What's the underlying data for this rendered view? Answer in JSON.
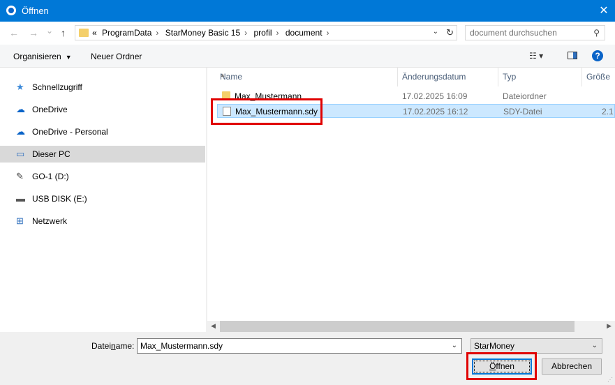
{
  "window": {
    "title": "Öffnen",
    "close_glyph": "✕"
  },
  "nav": {
    "back_glyph": "←",
    "forward_glyph": "→",
    "recent_glyph": "⌄",
    "up_glyph": "↑",
    "breadcrumb_prefix": "«",
    "breadcrumbs": [
      "ProgramData",
      "StarMoney Basic 15",
      "profil",
      "document"
    ],
    "separator": "›",
    "address_dropdown_glyph": "⌄",
    "refresh_glyph": "↻"
  },
  "search": {
    "placeholder": "document durchsuchen",
    "icon": "search-icon"
  },
  "toolbar": {
    "organize_label": "Organisieren",
    "new_folder_label": "Neuer Ordner",
    "view_glyph": "☷ ▾",
    "help_label": "?"
  },
  "sidebar": {
    "items": [
      {
        "label": "Schnellzugriff",
        "icon": "star-icon",
        "glyph": "★",
        "color": "#3a88d8"
      },
      {
        "label": "OneDrive",
        "icon": "cloud-icon",
        "glyph": "☁",
        "color": "#0a64c8"
      },
      {
        "label": "OneDrive - Personal",
        "icon": "cloud-icon",
        "glyph": "☁",
        "color": "#0a64c8"
      },
      {
        "label": "Dieser PC",
        "icon": "computer-icon",
        "glyph": "▭",
        "color": "#2f6fbd",
        "selected": true
      },
      {
        "label": "GO-1 (D:)",
        "icon": "usb-drive-icon",
        "glyph": "✎",
        "color": "#444444"
      },
      {
        "label": "USB DISK (E:)",
        "icon": "drive-icon",
        "glyph": "▬",
        "color": "#555555"
      },
      {
        "label": "Netzwerk",
        "icon": "network-icon",
        "glyph": "⊞",
        "color": "#2f6fbd"
      }
    ]
  },
  "filelist": {
    "columns": [
      "Name",
      "Änderungsdatum",
      "Typ",
      "Größe"
    ],
    "rows": [
      {
        "name": "Max_Mustermann",
        "date": "17.02.2025 16:09",
        "type": "Dateiordner",
        "size": "",
        "kind": "folder"
      },
      {
        "name": "Max_Mustermann.sdy",
        "date": "17.02.2025 16:12",
        "type": "SDY-Datei",
        "size": "2.1",
        "kind": "file",
        "selected": true
      }
    ]
  },
  "bottom": {
    "filename_label_pre": "Datei",
    "filename_label_ul": "n",
    "filename_label_post": "ame:",
    "filename_value": "Max_Mustermann.sdy",
    "filetype_value": "StarMoney",
    "open_label_pre": "",
    "open_label_ul": "Ö",
    "open_label_post": "ffnen",
    "cancel_label": "Abbrechen"
  },
  "colors": {
    "titlebar": "#0078d7",
    "highlight": "#e00000",
    "selection": "#cce8ff"
  }
}
